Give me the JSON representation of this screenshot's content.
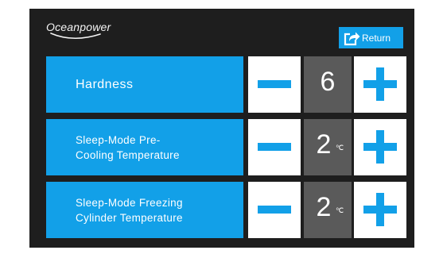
{
  "brand": {
    "name": "Oceanpower"
  },
  "header": {
    "return_label": "Return",
    "return_icon": "share-arrow-icon"
  },
  "colors": {
    "accent": "#12a0e8",
    "background": "#1e1e1e",
    "value_box": "#5a5a5a",
    "button": "#ffffff"
  },
  "settings": [
    {
      "label": "Hardness",
      "value": "6",
      "unit": ""
    },
    {
      "label": "Sleep-Mode Pre-\nCooling Temperature",
      "value": "2",
      "unit": "℃"
    },
    {
      "label": "Sleep-Mode Freezing\nCylinder Temperature",
      "value": "2",
      "unit": "℃"
    }
  ]
}
